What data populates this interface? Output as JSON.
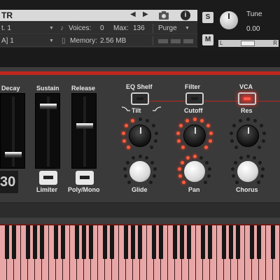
{
  "header": {
    "instrument_name": "TR",
    "output": "t. 1",
    "midi": "A]  1",
    "voices_label": "Voices:",
    "voices_value": "0",
    "max_label": "Max:",
    "max_value": "136",
    "memory_label": "Memory:",
    "memory_value": "2.56 MB",
    "purge_label": "Purge",
    "solo_label": "S",
    "mute_label": "M",
    "tune_label": "Tune",
    "tune_value": "0.00",
    "pan_left": "L",
    "pan_right": "R",
    "info_label": "i"
  },
  "controls": {
    "decay": "Decay",
    "sustain": "Sustain",
    "release": "Release",
    "eq_shelf": "EQ Shelf",
    "filter": "Filter",
    "vca": "VCA",
    "tilt": "Tilt",
    "cutoff": "Cutoff",
    "res": "Res",
    "glide": "Glide",
    "pan": "Pan",
    "chorus": "Chorus",
    "limiter": "Limiter",
    "poly_mono": "Poly/Mono",
    "display_value": "30"
  },
  "levels": {
    "decay_slider": 0.18,
    "sustain_slider": 0.9,
    "release_slider": 0.6
  },
  "colors": {
    "accent_red": "#c0261d",
    "led_on": "#ff5a3c",
    "key_white": "#e9a6a6"
  },
  "icons": {
    "camera": "camera-icon",
    "info": "info-icon",
    "nav": "arrow-icons"
  }
}
